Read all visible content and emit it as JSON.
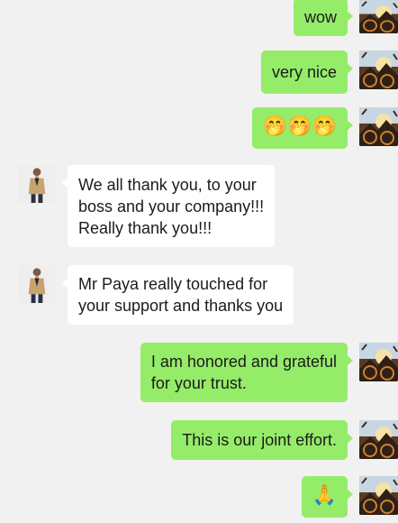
{
  "colors": {
    "background": "#f1f1f1",
    "sent_bubble": "#95ec69",
    "received_bubble": "#ffffff"
  },
  "messages": [
    {
      "sender": "me",
      "lines": [
        "wow"
      ]
    },
    {
      "sender": "me",
      "lines": [
        "very nice"
      ]
    },
    {
      "sender": "me",
      "lines": [
        "🤭🤭🤭"
      ]
    },
    {
      "sender": "contact",
      "lines": [
        "We all thank you, to your",
        "boss and your company!!!",
        "Really thank you!!!"
      ]
    },
    {
      "sender": "contact",
      "lines": [
        "Mr Paya really touched for",
        "your support and thanks you"
      ]
    },
    {
      "sender": "me",
      "lines": [
        "I am honored and grateful",
        "for your trust."
      ]
    },
    {
      "sender": "me",
      "lines": [
        "This is our joint effort."
      ]
    },
    {
      "sender": "me",
      "lines": [
        "🙏"
      ]
    }
  ]
}
